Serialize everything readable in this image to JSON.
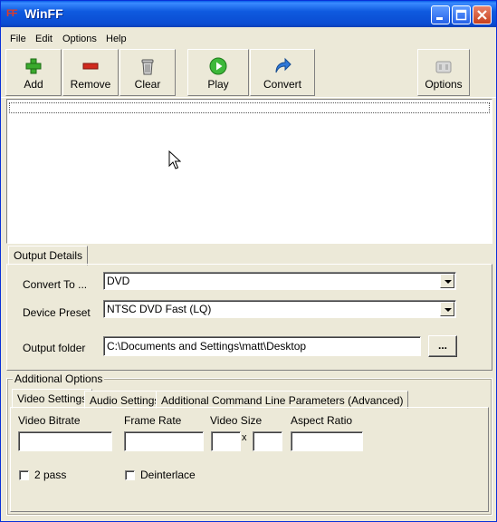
{
  "window": {
    "title": "WinFF",
    "icon_text": "FF"
  },
  "menu": [
    "File",
    "Edit",
    "Options",
    "Help"
  ],
  "toolbar": {
    "add": "Add",
    "remove": "Remove",
    "clear": "Clear",
    "play": "Play",
    "convert": "Convert",
    "options": "Options"
  },
  "output_details": {
    "tab_label": "Output Details",
    "convert_to_label": "Convert To ...",
    "convert_to_value": "DVD",
    "device_preset_label": "Device Preset",
    "device_preset_value": "NTSC DVD Fast (LQ)",
    "output_folder_label": "Output folder",
    "output_folder_value": "C:\\Documents and Settings\\matt\\Desktop",
    "browse_label": "..."
  },
  "additional_options": {
    "group_label": "Additional Options",
    "tabs": [
      "Video Settings",
      "Audio Settings",
      "Additional Command Line Parameters (Advanced)"
    ],
    "video_bitrate_label": "Video Bitrate",
    "frame_rate_label": "Frame Rate",
    "video_size_label": "Video Size",
    "size_separator": "x",
    "aspect_ratio_label": "Aspect Ratio",
    "two_pass_label": "2 pass",
    "deinterlace_label": "Deinterlace"
  }
}
